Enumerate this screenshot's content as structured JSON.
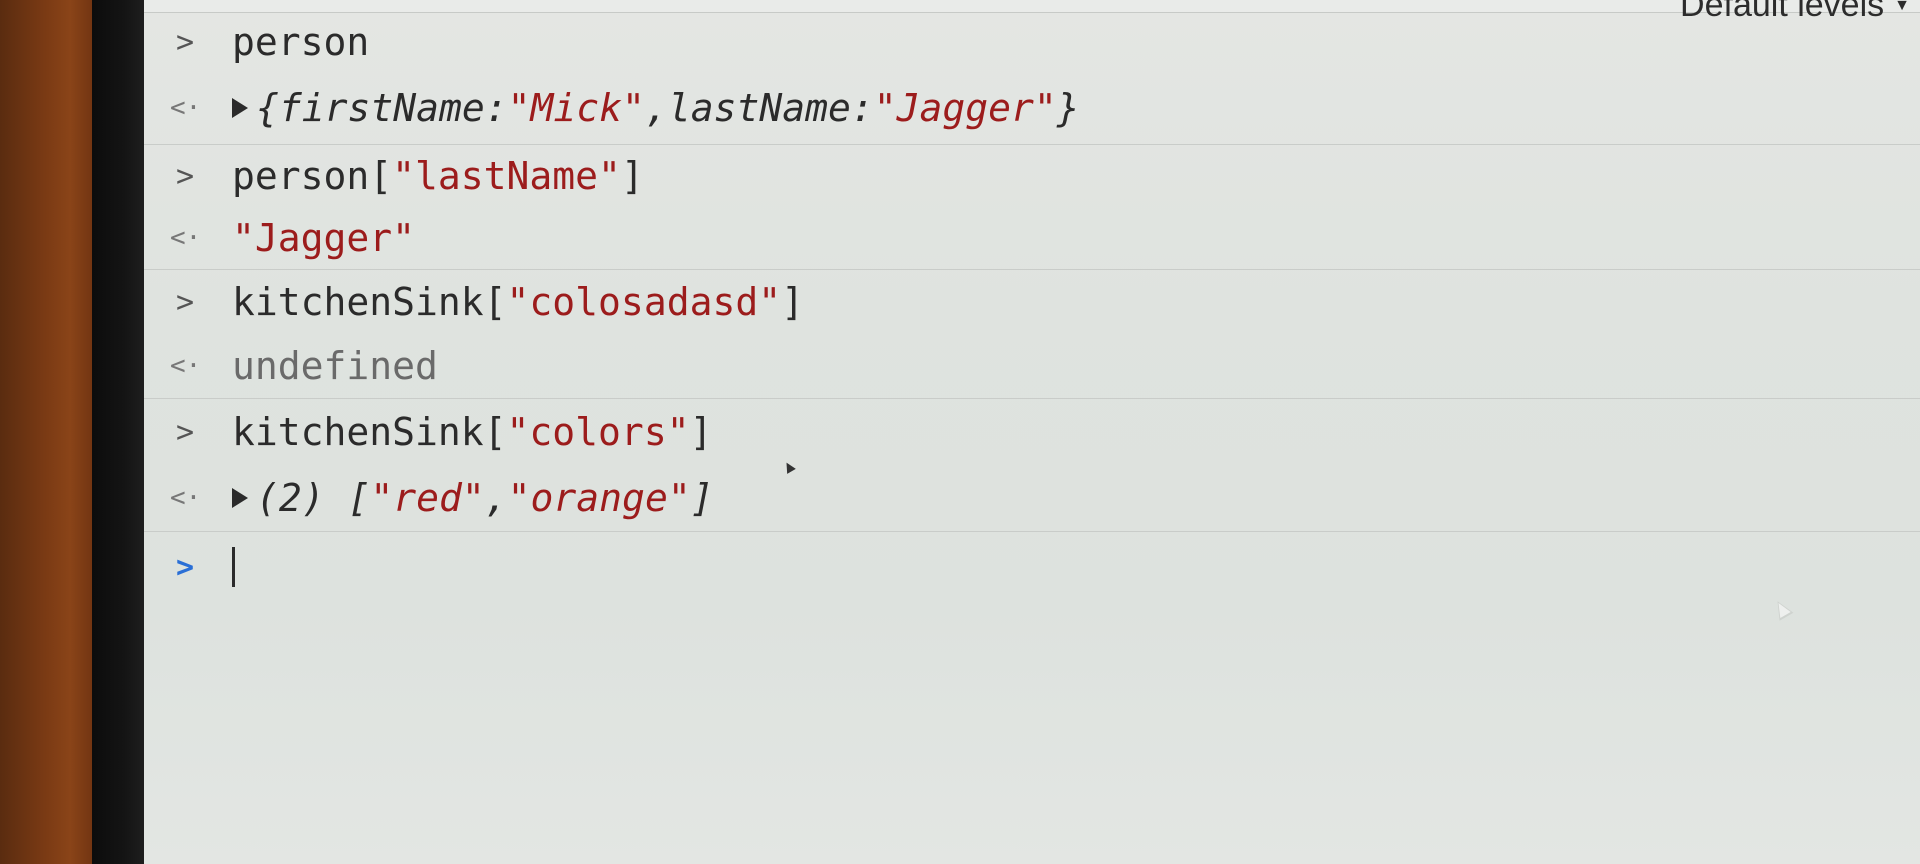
{
  "toolbar": {
    "levels_label": "Default levels",
    "levels_caret": "▼"
  },
  "prompts": {
    "input": ">",
    "result": "<·"
  },
  "console": {
    "entries": [
      {
        "input": "person",
        "result": {
          "prefix": "{",
          "k1": "firstName: ",
          "v1": "\"Mick\"",
          "sep": ", ",
          "k2": "lastName: ",
          "v2": "\"Jagger\"",
          "suffix": "}"
        }
      },
      {
        "input_code": "person[",
        "input_str": "\"lastName\"",
        "input_close": "]",
        "result": "\"Jagger\""
      },
      {
        "input_code": "kitchenSink[",
        "input_str": "\"colosadasd\"",
        "input_close": "]",
        "result": "undefined"
      },
      {
        "input_code": "kitchenSink[",
        "input_str": "\"colors\"",
        "input_close": "]",
        "result": {
          "count": "(2) [",
          "v1": "\"red\"",
          "sep": ", ",
          "v2": "\"orange\"",
          "close": "]"
        }
      }
    ]
  }
}
